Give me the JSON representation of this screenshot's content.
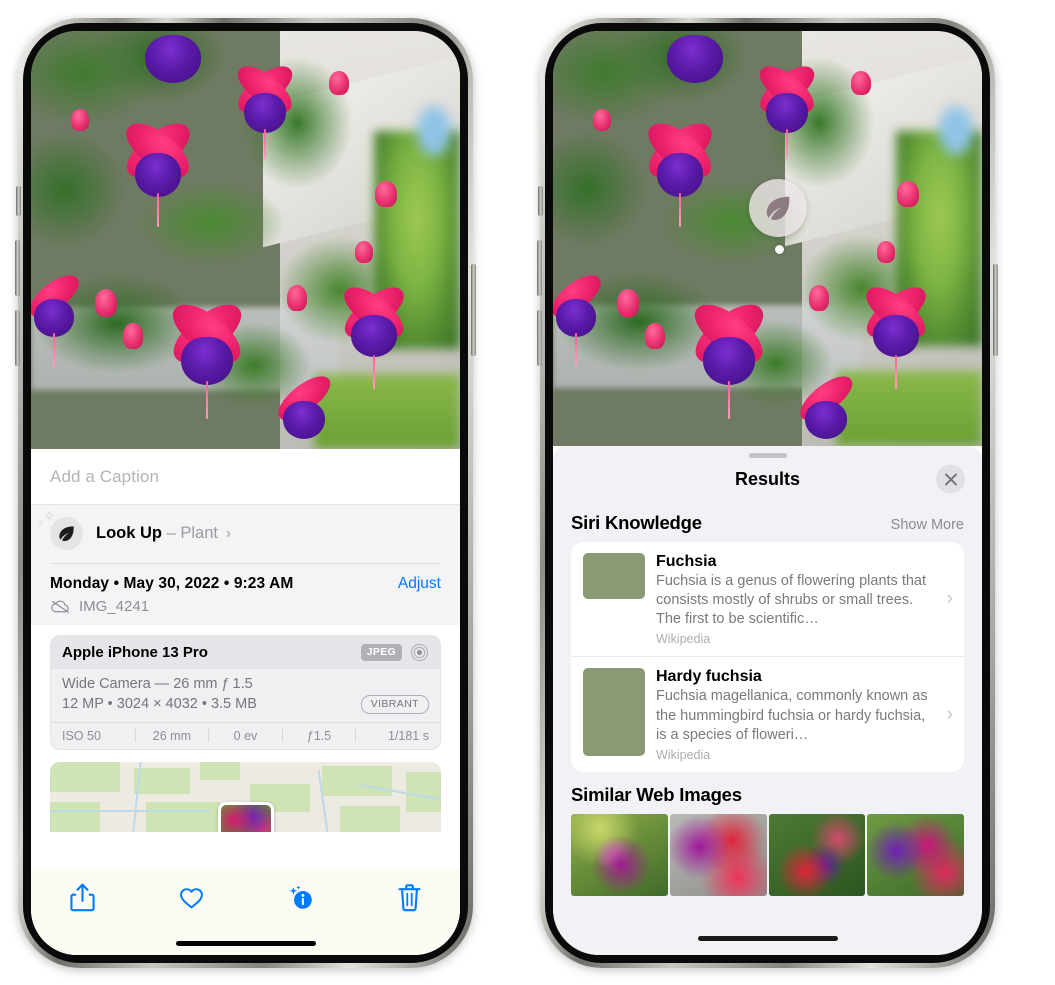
{
  "left_phone": {
    "photo": {
      "alt_name": "fuchsia-flowers-photo"
    },
    "caption": {
      "placeholder": "Add a Caption",
      "value": ""
    },
    "lookup": {
      "icon": "leaf-icon",
      "label": "Look Up",
      "dash": "–",
      "subject": "Plant",
      "chevron": "›"
    },
    "metadata": {
      "date_line": "Monday • May 30, 2022 • 9:23 AM",
      "adjust_label": "Adjust",
      "cloud_icon": "icloud-slash-icon",
      "filename": "IMG_4241"
    },
    "camera_card": {
      "device": "Apple iPhone 13 Pro",
      "format_badge": "JPEG",
      "aperture_icon": "aperture-icon",
      "lens": "Wide Camera — 26 mm ƒ 1.5",
      "specs": "12 MP • 3024 × 4032 • 3.5 MB",
      "style_badge": "VIBRANT",
      "exif": [
        "ISO 50",
        "26 mm",
        "0 ev",
        "ƒ1.5",
        "1/181 s"
      ]
    },
    "map": {
      "name": "photo-location-map",
      "pin": "photo-pin-thumbnail"
    },
    "toolbar": [
      {
        "name": "share-button",
        "icon": "share-icon"
      },
      {
        "name": "favorite-button",
        "icon": "heart-icon"
      },
      {
        "name": "info-button",
        "icon": "sparkle-info-icon"
      },
      {
        "name": "delete-button",
        "icon": "trash-icon"
      }
    ]
  },
  "right_phone": {
    "lookup_badge": {
      "icon": "leaf-icon",
      "name": "visual-look-up-badge"
    },
    "sheet": {
      "title": "Results",
      "close_icon": "close-icon",
      "grabber": "sheet-grabber"
    },
    "siri_knowledge": {
      "section_title": "Siri Knowledge",
      "show_more": "Show More",
      "items": [
        {
          "title": "Fuchsia",
          "description": "Fuchsia is a genus of flowering plants that consists mostly of shrubs or small trees. The first to be scientific…",
          "source": "Wikipedia",
          "chevron": "›"
        },
        {
          "title": "Hardy fuchsia",
          "description": "Fuchsia magellanica, commonly known as the hummingbird fuchsia or hardy fuchsia, is a species of floweri…",
          "source": "Wikipedia",
          "chevron": "›"
        }
      ]
    },
    "similar_web_images": {
      "section_title": "Similar Web Images",
      "thumbnails": [
        "fuchsia-web-image-1",
        "fuchsia-web-image-2",
        "fuchsia-web-image-3",
        "fuchsia-web-image-4"
      ]
    }
  },
  "colors": {
    "accent_blue": "#007aff",
    "sheet_bg": "#f2f2f6",
    "card_bg": "#ffffff",
    "secondary_text": "#8e8e93"
  }
}
